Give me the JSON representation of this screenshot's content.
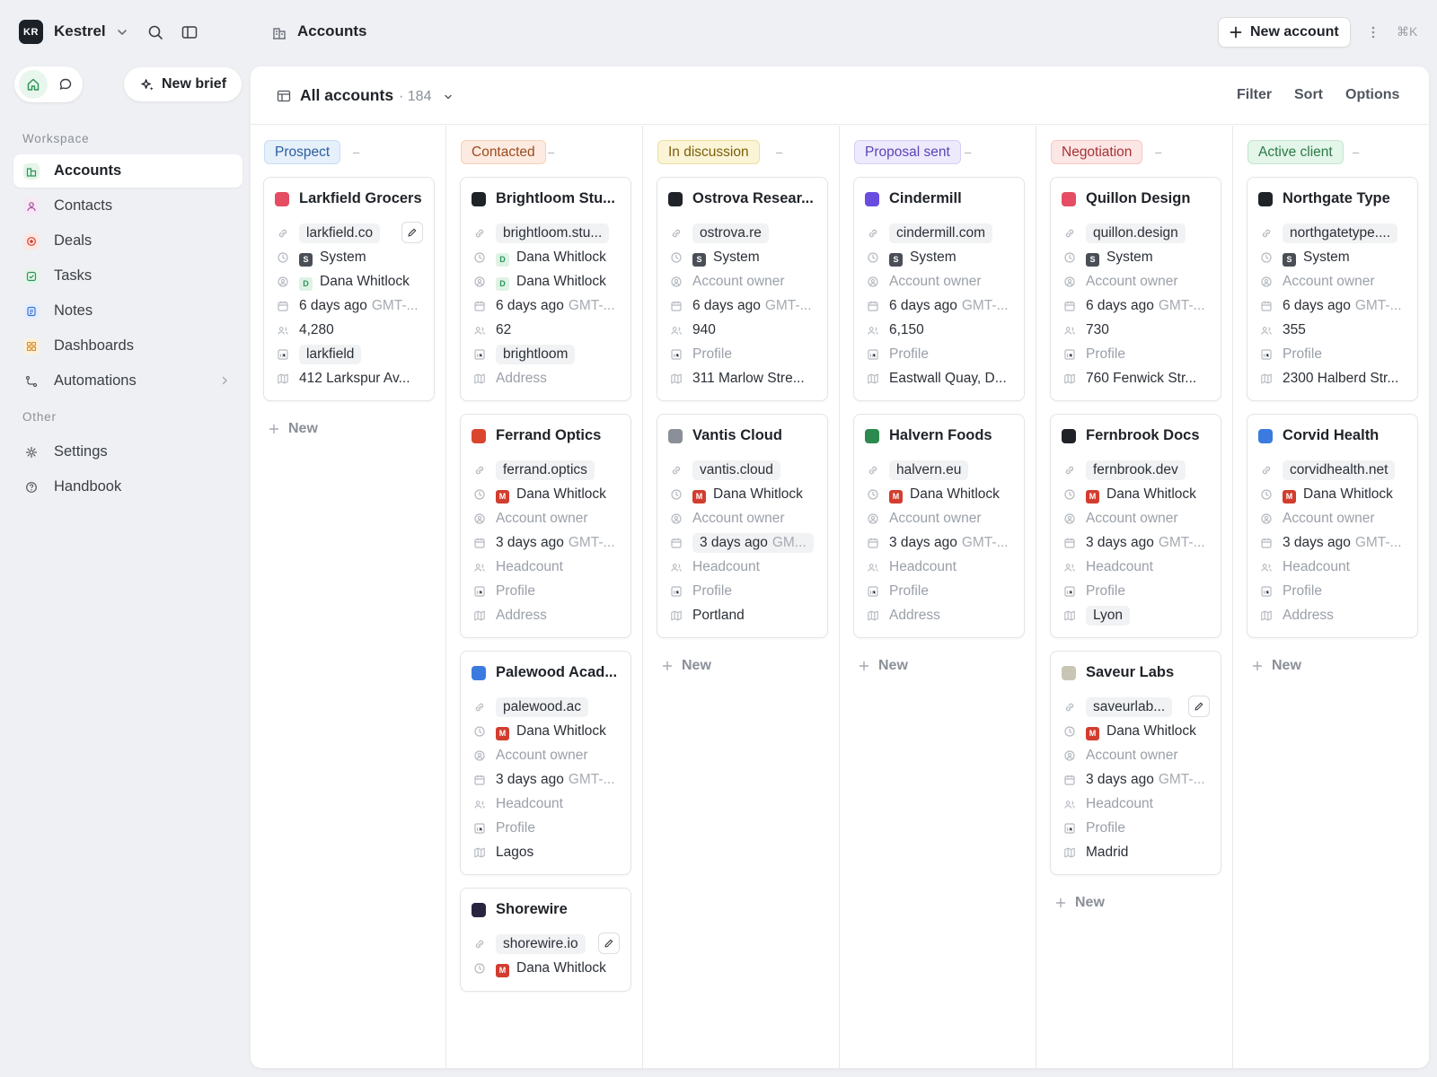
{
  "app": {
    "workspace_initials": "KR",
    "workspace_name": "Kestrel",
    "shortcut_hint": "⌘K"
  },
  "header": {
    "breadcrumb": "Accounts",
    "new_account_label": "New account"
  },
  "sidebar": {
    "new_brief_label": "New brief",
    "workspace_section": "Workspace",
    "other_section": "Other",
    "items": [
      {
        "label": "Accounts",
        "icon": "building-icon",
        "color": "#2e9458"
      },
      {
        "label": "Contacts",
        "icon": "person-icon",
        "color": "#a4479c"
      },
      {
        "label": "Deals",
        "icon": "target-icon",
        "color": "#d23d2f"
      },
      {
        "label": "Tasks",
        "icon": "check-square-icon",
        "color": "#2e9458"
      },
      {
        "label": "Notes",
        "icon": "note-icon",
        "color": "#3b6fd8"
      },
      {
        "label": "Dashboards",
        "icon": "grid-icon",
        "color": "#d48a1e"
      },
      {
        "label": "Automations",
        "icon": "flow-icon",
        "color": "#50565e"
      }
    ],
    "other_items": [
      {
        "label": "Settings",
        "icon": "gear-icon"
      },
      {
        "label": "Handbook",
        "icon": "help-icon"
      }
    ]
  },
  "view": {
    "title": "All accounts",
    "count": "· 184",
    "filter": "Filter",
    "sort": "Sort",
    "options": "Options"
  },
  "new_label": "New",
  "columns": [
    {
      "stage": "Prospect",
      "bg": "#e6f0fb",
      "border": "#c9dcf3",
      "fg": "#2a5d9f",
      "cards": [
        {
          "name": "Larkfield Grocers",
          "color": "#e44d63",
          "domain": "larkfield.co",
          "edit": true,
          "created_by": {
            "av": "S",
            "name": "System"
          },
          "owner": {
            "av": "D",
            "name": "Dana Whitlock"
          },
          "date": "6 days ago",
          "tz": "GMT-...",
          "headcount": "4,280",
          "profile": "larkfield",
          "profile_pill": true,
          "address": "412 Larkspur Av..."
        }
      ]
    },
    {
      "stage": "Contacted",
      "bg": "#fdebe1",
      "border": "#f6cfb8",
      "fg": "#9c4a1c",
      "cards": [
        {
          "name": "Brightloom Stu...",
          "color": "#1f2328",
          "domain": "brightloom.stu...",
          "created_by": {
            "av": "D",
            "name": "Dana Whitlock"
          },
          "owner": {
            "av": "D",
            "name": "Dana Whitlock"
          },
          "date": "6 days ago",
          "tz": "GMT-...",
          "headcount": "62",
          "profile": "brightloom",
          "profile_pill": true,
          "address": "Address"
        },
        {
          "name": "Ferrand Optics",
          "color": "#d9452f",
          "domain": "ferrand.optics",
          "created_by": {
            "av": "M",
            "name": "Dana Whitlock"
          },
          "owner": {
            "av": "",
            "name": "Account owner"
          },
          "date": "3 days ago",
          "tz": "GMT-...",
          "headcount": "Headcount",
          "profile": "Profile",
          "address": "Address"
        },
        {
          "name": "Palewood Acad...",
          "color": "#3b7be0",
          "domain": "palewood.ac",
          "created_by": {
            "av": "M",
            "name": "Dana Whitlock"
          },
          "owner": {
            "av": "",
            "name": "Account owner"
          },
          "date": "3 days ago",
          "tz": "GMT-...",
          "headcount": "Headcount",
          "profile": "Profile",
          "address": "Lagos"
        },
        {
          "name": "Shorewire",
          "color": "#2a2440",
          "domain": "shorewire.io",
          "edit": true,
          "short": true,
          "created_by": {
            "av": "M",
            "name": "Dana Whitlock"
          }
        }
      ]
    },
    {
      "stage": "In discussion",
      "bg": "#fbf4d6",
      "border": "#ecdf9f",
      "fg": "#7a5f0a",
      "cards": [
        {
          "name": "Ostrova Resear...",
          "color": "#1f2328",
          "domain": "ostrova.re",
          "created_by": {
            "av": "S",
            "name": "System"
          },
          "owner": {
            "av": "",
            "name": "Account owner"
          },
          "date": "6 days ago",
          "tz": "GMT-...",
          "headcount": "940",
          "profile": "Profile",
          "address": "311 Marlow Stre..."
        },
        {
          "name": "Vantis Cloud",
          "color": "#8a8f98",
          "domain": "vantis.cloud",
          "created_by": {
            "av": "M",
            "name": "Dana Whitlock"
          },
          "owner": {
            "av": "",
            "name": "Account owner"
          },
          "date": "3 days ago",
          "tz": "GM...",
          "date_pill": true,
          "headcount": "Headcount",
          "profile": "Profile",
          "address": "Portland"
        }
      ]
    },
    {
      "stage": "Proposal sent",
      "bg": "#eeeafd",
      "border": "#d6cef7",
      "fg": "#5b43b8",
      "cards": [
        {
          "name": "Cindermill",
          "color": "#6a4de0",
          "domain": "cindermill.com",
          "created_by": {
            "av": "S",
            "name": "System"
          },
          "owner": {
            "av": "",
            "name": "Account owner"
          },
          "date": "6 days ago",
          "tz": "GMT-...",
          "headcount": "6,150",
          "profile": "Profile",
          "address": "Eastwall Quay, D..."
        },
        {
          "name": "Halvern Foods",
          "color": "#2c8a4f",
          "domain": "halvern.eu",
          "created_by": {
            "av": "M",
            "name": "Dana Whitlock"
          },
          "owner": {
            "av": "",
            "name": "Account owner"
          },
          "date": "3 days ago",
          "tz": "GMT-...",
          "headcount": "Headcount",
          "profile": "Profile",
          "address": "Address"
        }
      ]
    },
    {
      "stage": "Negotiation",
      "bg": "#fde6e6",
      "border": "#f6c6c6",
      "fg": "#a83232",
      "cards": [
        {
          "name": "Quillon Design",
          "color": "#e44d63",
          "domain": "quillon.design",
          "created_by": {
            "av": "S",
            "name": "System"
          },
          "owner": {
            "av": "",
            "name": "Account owner"
          },
          "date": "6 days ago",
          "tz": "GMT-...",
          "headcount": "730",
          "profile": "Profile",
          "address": "760 Fenwick Str..."
        },
        {
          "name": "Fernbrook Docs",
          "color": "#1f2328",
          "domain": "fernbrook.dev",
          "created_by": {
            "av": "M",
            "name": "Dana Whitlock"
          },
          "owner": {
            "av": "",
            "name": "Account owner"
          },
          "date": "3 days ago",
          "tz": "GMT-...",
          "headcount": "Headcount",
          "profile": "Profile",
          "address": "Lyon",
          "address_pill": true
        },
        {
          "name": "Saveur Labs",
          "color": "#c9c5b5",
          "domain": "saveurlab...",
          "edit": true,
          "created_by": {
            "av": "M",
            "name": "Dana Whitlock"
          },
          "owner": {
            "av": "",
            "name": "Account owner"
          },
          "date": "3 days ago",
          "tz": "GMT-...",
          "headcount": "Headcount",
          "profile": "Profile",
          "address": "Madrid"
        }
      ]
    },
    {
      "stage": "Active client",
      "bg": "#e4f5ea",
      "border": "#c4e6cf",
      "fg": "#2a7a46",
      "cards": [
        {
          "name": "Northgate Type",
          "color": "#1f2328",
          "domain": "northgatetype....",
          "created_by": {
            "av": "S",
            "name": "System"
          },
          "owner": {
            "av": "",
            "name": "Account owner"
          },
          "date": "6 days ago",
          "tz": "GMT-...",
          "headcount": "355",
          "profile": "Profile",
          "address": "2300 Halberd Str..."
        },
        {
          "name": "Corvid Health",
          "color": "#3b7be0",
          "domain": "corvidhealth.net",
          "created_by": {
            "av": "M",
            "name": "Dana Whitlock"
          },
          "owner": {
            "av": "",
            "name": "Account owner"
          },
          "date": "3 days ago",
          "tz": "GMT-...",
          "headcount": "Headcount",
          "profile": "Profile",
          "address": "Address"
        }
      ]
    }
  ]
}
